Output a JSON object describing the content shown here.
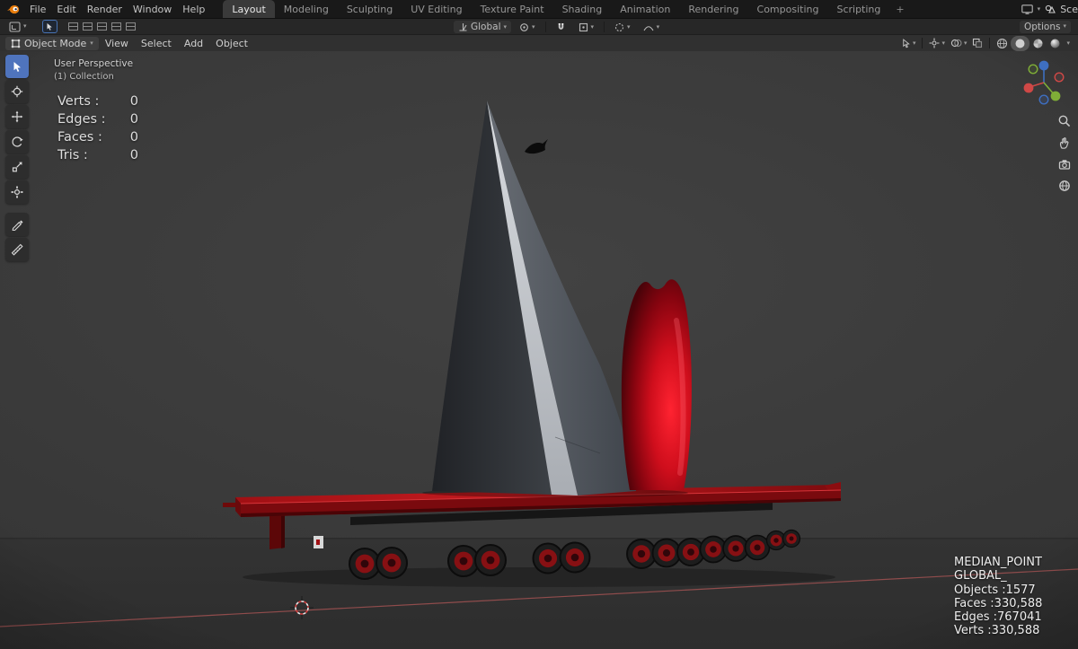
{
  "icons": {
    "caret": "▾",
    "plus": "+"
  },
  "topbar": {
    "menus": [
      "File",
      "Edit",
      "Render",
      "Window",
      "Help"
    ],
    "tabs": [
      "Layout",
      "Modeling",
      "Sculpting",
      "UV Editing",
      "Texture Paint",
      "Shading",
      "Animation",
      "Rendering",
      "Compositing",
      "Scripting"
    ],
    "active_tab": "Layout",
    "scene_label": "Sce"
  },
  "tool_settings": {
    "orientation_label": "Global",
    "options_label": "Options"
  },
  "viewport_header": {
    "mode_label": "Object Mode",
    "menus": [
      "View",
      "Select",
      "Add",
      "Object"
    ]
  },
  "viewport": {
    "view_label": "User Perspective",
    "collection_label": "(1) Collection",
    "stats": {
      "rows": [
        {
          "label": "Verts :",
          "value": "0"
        },
        {
          "label": "Edges :",
          "value": "0"
        },
        {
          "label": "Faces :",
          "value": "0"
        },
        {
          "label": "Tris :",
          "value": "0"
        }
      ]
    },
    "hud": {
      "lines": [
        "MEDIAN_POINT",
        "GLOBAL_",
        "Objects :1577",
        "Faces :330,588",
        "Edges :767041",
        "Verts :330,588"
      ]
    }
  },
  "tools": [
    "select-box",
    "cursor",
    "move",
    "rotate",
    "scale",
    "transform",
    "annotate",
    "measure"
  ],
  "colors": {
    "accent_blue": "#4772b3",
    "blender_orange": "#e87d0d",
    "trailer_red": "#a01014",
    "axis_x_red": "#9b5050"
  }
}
